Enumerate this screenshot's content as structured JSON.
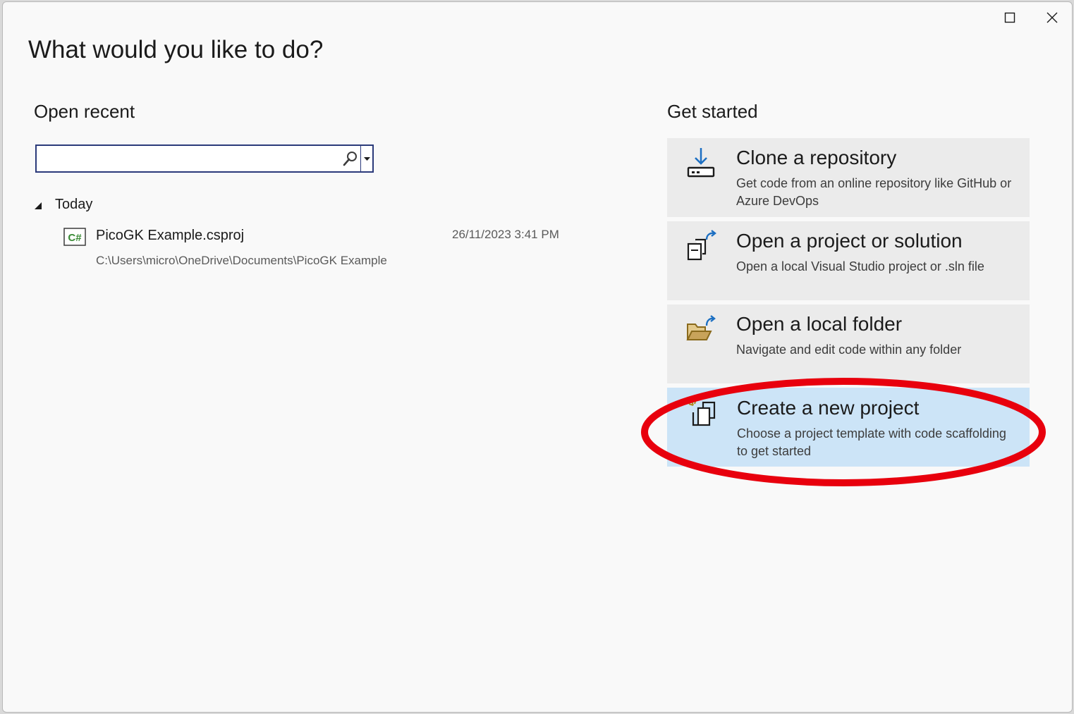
{
  "window": {
    "title": "What would you like to do?",
    "controls": {
      "maximize_icon": "maximize-icon",
      "close_icon": "close-icon"
    }
  },
  "open_recent": {
    "heading": "Open recent",
    "search": {
      "value": "",
      "placeholder": "",
      "icon": "search-icon"
    },
    "groups": [
      {
        "label": "Today",
        "items": [
          {
            "name": "PicoGK Example.csproj",
            "date": "26/11/2023 3:41 PM",
            "path": "C:\\Users\\micro\\OneDrive\\Documents\\PicoGK Example",
            "icon": "csharp-project-icon"
          }
        ]
      }
    ]
  },
  "get_started": {
    "heading": "Get started",
    "cards": [
      {
        "title": "Clone a repository",
        "description": "Get code from an online repository like GitHub or Azure DevOps",
        "icon": "clone-download-icon"
      },
      {
        "title": "Open a project or solution",
        "description": "Open a local Visual Studio project or .sln file",
        "icon": "open-project-icon"
      },
      {
        "title": "Open a local folder",
        "description": "Navigate and edit code within any folder",
        "icon": "open-folder-icon"
      },
      {
        "title": "Create a new project",
        "description": "Choose a project template with code scaffolding to get started",
        "icon": "new-project-icon",
        "selected": true
      }
    ]
  },
  "colors": {
    "accent_border": "#2b3a7a",
    "card_background": "#ebebeb",
    "card_selected": "#cce4f7",
    "highlight_annotation": "#e8000d",
    "csharp_green": "#388a34",
    "icon_blue": "#1c6fc2",
    "folder_gold": "#c8a35a"
  }
}
